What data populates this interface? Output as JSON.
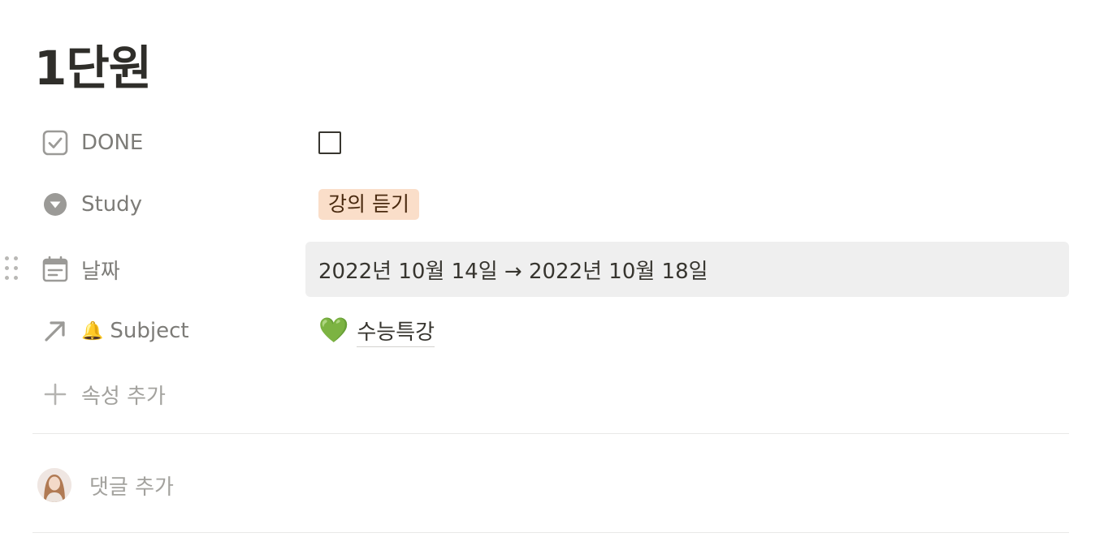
{
  "page": {
    "title": "1단원"
  },
  "properties": {
    "done": {
      "label": "DONE",
      "icon": "checkbox-property-icon",
      "checked": false
    },
    "study": {
      "label": "Study",
      "icon": "select-property-icon",
      "value": "강의 듣기",
      "tag_color": "#fadec9"
    },
    "date": {
      "label": "날짜",
      "icon": "calendar-icon",
      "value": "2022년 10월 14일 → 2022년 10월 18일"
    },
    "subject": {
      "label_emoji": "🔔",
      "label": "Subject",
      "icon": "relation-arrow-icon",
      "value_emoji": "💚",
      "value": "수능특강"
    }
  },
  "add_property": {
    "label": "속성 추가",
    "icon": "plus-icon"
  },
  "comment": {
    "placeholder": "댓글 추가",
    "avatar": "user-avatar"
  }
}
